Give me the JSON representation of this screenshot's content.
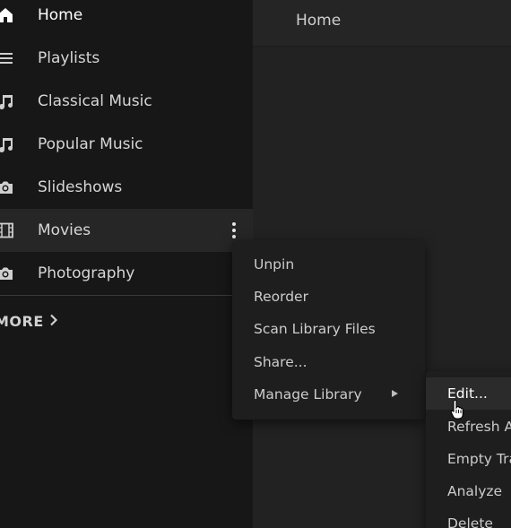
{
  "header": {
    "title": "Home"
  },
  "sidebar": {
    "items": [
      {
        "label": "Home",
        "icon": "home-icon"
      },
      {
        "label": "Playlists",
        "icon": "list-icon"
      },
      {
        "label": "Classical Music",
        "icon": "music-note-icon"
      },
      {
        "label": "Popular Music",
        "icon": "music-note-icon"
      },
      {
        "label": "Slideshows",
        "icon": "camera-icon"
      },
      {
        "label": "Movies",
        "icon": "film-icon"
      },
      {
        "label": "Photography",
        "icon": "camera-icon"
      }
    ],
    "more_label": "MORE"
  },
  "context_menu": {
    "items": [
      {
        "label": "Unpin"
      },
      {
        "label": "Reorder"
      },
      {
        "label": "Scan Library Files"
      },
      {
        "label": "Share..."
      },
      {
        "label": "Manage Library"
      }
    ]
  },
  "submenu": {
    "items": [
      {
        "label": "Edit..."
      },
      {
        "label": "Refresh All"
      },
      {
        "label": "Empty Trash"
      },
      {
        "label": "Analyze"
      },
      {
        "label": "Delete"
      }
    ]
  },
  "colors": {
    "sidebar_bg": "#171717",
    "main_bg": "#222222",
    "menu_bg": "#1e1e1e",
    "selected_bg": "#262626"
  }
}
